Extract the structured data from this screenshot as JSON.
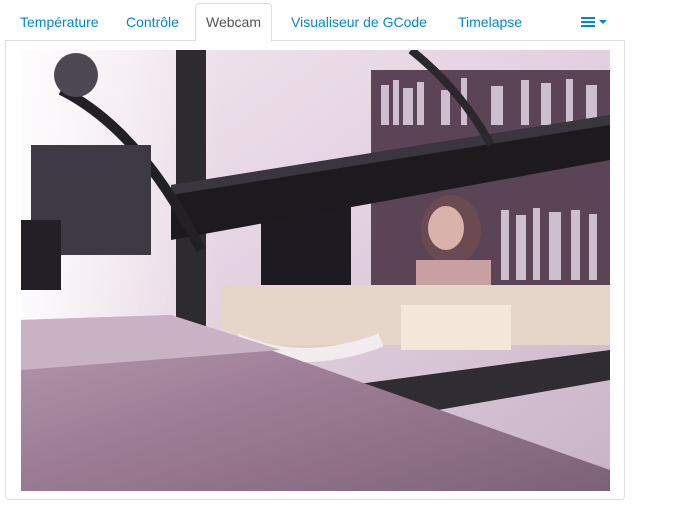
{
  "tabs": [
    {
      "label": "Température",
      "active": false
    },
    {
      "label": "Contrôle",
      "active": false
    },
    {
      "label": "Webcam",
      "active": true
    },
    {
      "label": "Visualiseur de GCode",
      "active": false
    },
    {
      "label": "Timelapse",
      "active": false
    }
  ],
  "menu": {
    "icon": "hamburger-icon",
    "caret_icon": "caret-down-icon"
  },
  "colors": {
    "link": "#0088cc",
    "active_tab_text": "#555555",
    "border": "#dddddd"
  },
  "webcam": {
    "content": "webcam-stream-image"
  }
}
